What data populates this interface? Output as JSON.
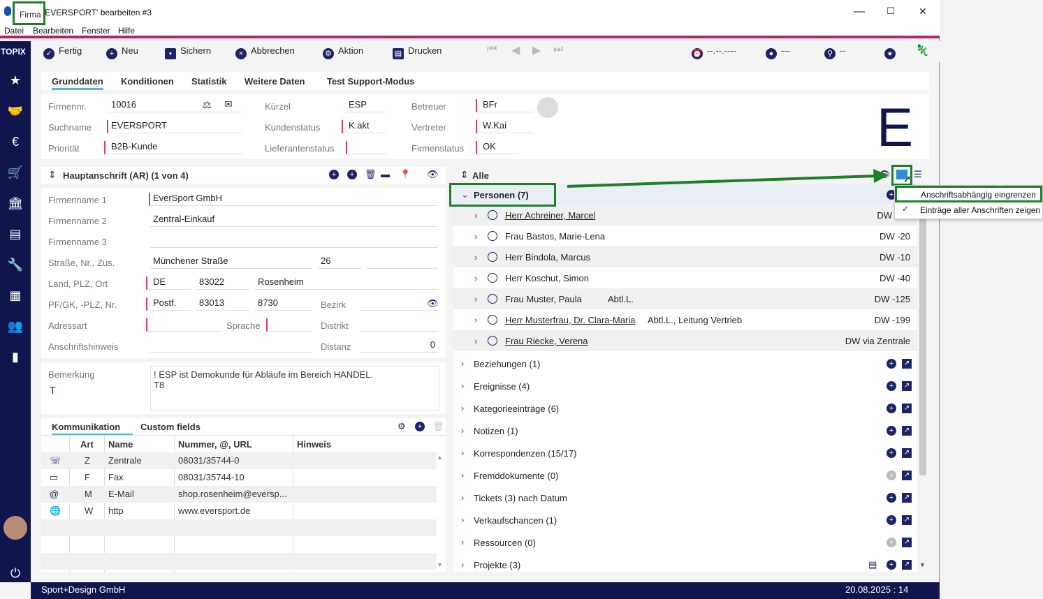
{
  "window": {
    "title_prefix": "Firma",
    "title": "'EVERSPORT' bearbeiten #3",
    "minimize": "—",
    "maximize": "☐",
    "close": "✕"
  },
  "menu": [
    "Datei",
    "Bearbeiten",
    "Fenster",
    "Hilfe"
  ],
  "sidebar": {
    "logo": "TOPIX",
    "items": [
      "favorites-icon",
      "handshake-icon",
      "euro-icon",
      "cart-icon",
      "bank-icon",
      "archive-icon",
      "wrench-icon",
      "calculator-icon",
      "people-icon",
      "chart-icon"
    ]
  },
  "toolbar": {
    "fertig": "Fertig",
    "neu": "Neu",
    "sichern": "Sichern",
    "abbrechen": "Abbrechen",
    "aktion": "Aktion",
    "drucken": "Drucken",
    "date_placeholder": "--.--.----",
    "user_placeholder": "---",
    "attach_placeholder": "--"
  },
  "tabs": [
    "Grunddaten",
    "Konditionen",
    "Statistik",
    "Weitere Daten",
    "Test Support-Modus"
  ],
  "header": {
    "firmennr_label": "Firmennr.",
    "firmennr": "10016",
    "suchname_label": "Suchname",
    "suchname": "EVERSPORT",
    "prioritaet_label": "Priorität",
    "prioritaet": "B2B-Kunde",
    "kuerzel_label": "Kürzel",
    "kuerzel": "ESP",
    "kundenstatus_label": "Kundenstatus",
    "kundenstatus": "K.akt",
    "lieferantenstatus_label": "Lieferantenstatus",
    "lieferantenstatus": "",
    "betreuer_label": "Betreuer",
    "betreuer": "BFr",
    "vertreter_label": "Vertreter",
    "vertreter": "W.Kai",
    "firmenstatus_label": "Firmenstatus",
    "firmenstatus": "OK",
    "logo_letter": "E"
  },
  "address": {
    "header": "Hauptanschrift (AR) (1 von 4)",
    "firmenname1_label": "Firmenname 1",
    "firmenname1": "EverSport GmbH",
    "firmenname2_label": "Firmenname 2",
    "firmenname2": "Zentral-Einkauf",
    "firmenname3_label": "Firmenname 3",
    "firmenname3": "",
    "strasse_label": "Straße, Nr., Zus.",
    "strasse": "Münchener Straße",
    "hausnr": "26",
    "land_label": "Land, PLZ, Ort",
    "land": "DE",
    "plz": "83022",
    "ort": "Rosenheim",
    "pf_label": "PF/GK, -PLZ, Nr.",
    "pf": "Postf.",
    "pfplz": "83013",
    "pfnr": "8730",
    "bezirk_label": "Bezirk",
    "adressart_label": "Adressart",
    "sprache_label": "Sprache",
    "distrikt_label": "Distrikt",
    "hinweis_label": "Anschriftshinweis",
    "distanz_label": "Distanz",
    "distanz": "0"
  },
  "remark": {
    "label": "Bemerkung",
    "line1": "! ESP ist Demokunde für Abläufe im Bereich HANDEL.",
    "line2": "T8"
  },
  "comm": {
    "tab1": "Kommunikation",
    "tab2": "Custom fields",
    "columns": [
      "Art",
      "Name",
      "Nummer, @, URL",
      "Hinweis"
    ],
    "rows": [
      {
        "icon": "phone-icon",
        "art": "Z",
        "name": "Zentrale",
        "nummer": "08031/35744-0"
      },
      {
        "icon": "fax-icon",
        "art": "F",
        "name": "Fax",
        "nummer": "08031/35744-10"
      },
      {
        "icon": "at-icon",
        "art": "M",
        "name": "E-Mail",
        "nummer": "shop.rosenheim@eversp..."
      },
      {
        "icon": "globe-icon",
        "art": "W",
        "name": "http",
        "nummer": "www.eversport.de"
      }
    ]
  },
  "right": {
    "filter": "Alle",
    "personen": "Personen (7)",
    "persons": [
      {
        "name": "Herr Achreiner, Marcel",
        "extra": "",
        "dw": "DW",
        "link": true
      },
      {
        "name": "Frau Bastos, Marie-Lena",
        "extra": "",
        "dw": "DW -20",
        "link": false
      },
      {
        "name": "Herr Bindola, Marcus",
        "extra": "",
        "dw": "DW -10",
        "link": false
      },
      {
        "name": "Herr Koschut, Simon",
        "extra": "",
        "dw": "DW -40",
        "link": false
      },
      {
        "name": "Frau Muster, Paula",
        "extra": "Abtl.L.",
        "dw": "DW -125",
        "link": false
      },
      {
        "name": "Herr Musterfrau, Dr. Clara-Maria",
        "extra": "Abtl.L., Leitung Vertrieb",
        "dw": "DW -199",
        "link": true
      },
      {
        "name": "Frau Riecke, Verena",
        "extra": "",
        "dw": "DW via Zentrale",
        "link": true
      }
    ],
    "sections": [
      {
        "label": "Beziehungen (1)",
        "enabled": true
      },
      {
        "label": "Ereignisse (4)",
        "enabled": true
      },
      {
        "label": "Kategorieeinträge (6)",
        "enabled": true
      },
      {
        "label": "Notizen (1)",
        "enabled": true
      },
      {
        "label": "Korrespondenzen (15/17)",
        "enabled": true
      },
      {
        "label": "Fremddokumente (0)",
        "enabled": false
      },
      {
        "label": "Tickets (3) nach Datum",
        "enabled": true
      },
      {
        "label": "Verkaufschancen (1)",
        "enabled": true
      },
      {
        "label": "Ressourcen (0)",
        "enabled": false
      },
      {
        "label": "Projekte (3)",
        "enabled": true
      }
    ]
  },
  "popup": {
    "item1": "Anschriftsabhängig eingrenzen",
    "item2": "Einträge aller Anschriften zeigen",
    "check": "✓"
  },
  "status": {
    "company": "Sport+Design GmbH",
    "datetime": "20.08.2025 : 14"
  },
  "colors": {
    "accent": "#b8226a",
    "navy": "#10154e",
    "highlight": "#1e7e2a",
    "required": "#e23a55"
  }
}
